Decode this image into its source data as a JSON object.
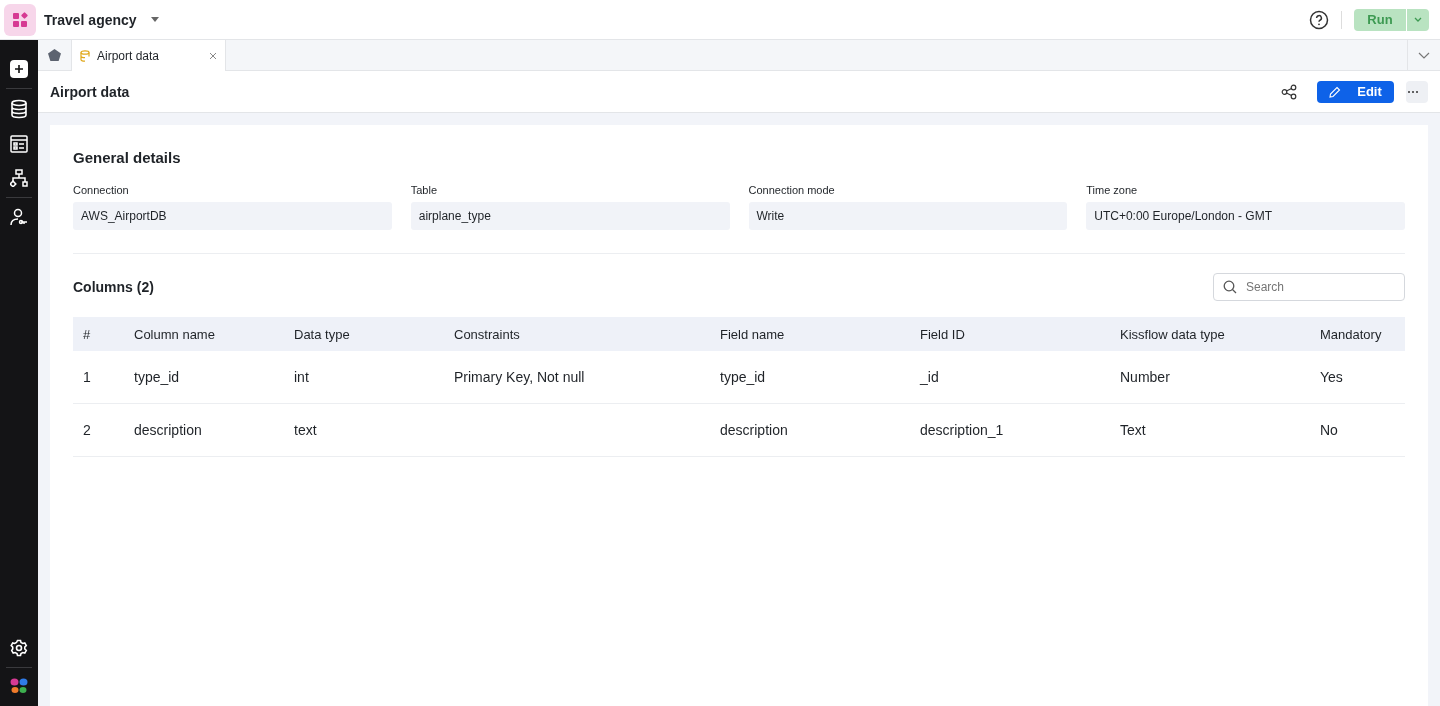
{
  "app": {
    "title": "Travel agency"
  },
  "run_button": {
    "label": "Run",
    "disabled": true
  },
  "tabs": [
    {
      "label": "Airport data",
      "selected": true
    }
  ],
  "page": {
    "title": "Airport data",
    "edit_label": "Edit"
  },
  "general": {
    "title": "General details",
    "fields": [
      {
        "label": "Connection",
        "value": "AWS_AirportDB"
      },
      {
        "label": "Table",
        "value": "airplane_type"
      },
      {
        "label": "Connection mode",
        "value": "Write"
      },
      {
        "label": "Time zone",
        "value": "UTC+0:00 Europe/London - GMT"
      }
    ]
  },
  "columns_section": {
    "title": "Columns (2)",
    "search": {
      "placeholder": "Search"
    }
  },
  "table": {
    "columns": [
      "#",
      "Column name",
      "Data type",
      "Constraints",
      "Field name",
      "Field ID",
      "Kissflow data type",
      "Mandatory"
    ],
    "rows": [
      [
        "1",
        "type_id",
        "int",
        "Primary Key, Not null",
        "type_id",
        "_id",
        "Number",
        "Yes"
      ],
      [
        "2",
        "description",
        "text",
        "",
        "description",
        "description_1",
        "Text",
        "No"
      ]
    ]
  }
}
